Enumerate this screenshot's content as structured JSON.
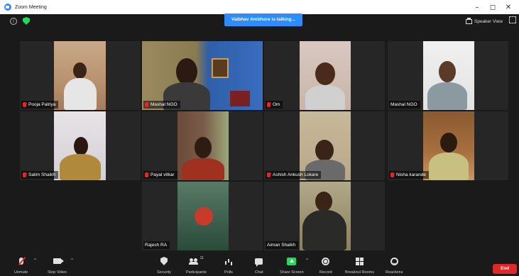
{
  "window": {
    "title": "Zoom Meeting",
    "controls": {
      "minimize": "–",
      "maximize": "◻",
      "close": "✕"
    }
  },
  "meeting": {
    "talking_banner": "Vaibhav Ambhore is talking...",
    "speaker_view_label": "Speaker View",
    "info_icon": "i"
  },
  "participants": [
    {
      "name": "Pooja Palriya",
      "muted": true
    },
    {
      "name": "Mashal NGO",
      "muted": true
    },
    {
      "name": "Om",
      "muted": true
    },
    {
      "name": "Mashal NGO",
      "muted": false
    },
    {
      "name": "Salim Shaikh",
      "muted": true
    },
    {
      "name": "Payal vitkar",
      "muted": true
    },
    {
      "name": "Ashish Ankush Lokare",
      "muted": true
    },
    {
      "name": "Nisha karande",
      "muted": true
    },
    {
      "name": "Rajesh RA",
      "muted": false
    },
    {
      "name": "Aiman Shaikh",
      "muted": false
    }
  ],
  "toolbar": {
    "unmute": "Unmute",
    "stop_video": "Stop Video",
    "security": "Security",
    "participants": "Participants",
    "participants_count": "11",
    "polls": "Polls",
    "chat": "Chat",
    "share_screen": "Share Screen",
    "record": "Record",
    "breakout_rooms": "Breakout Rooms",
    "reactions": "Reactions",
    "end": "End",
    "caret": "^"
  },
  "colors": {
    "accent": "#2d8cff",
    "muted_red": "#e02828",
    "share_green": "#23d959",
    "tile_bg": "#262626"
  }
}
